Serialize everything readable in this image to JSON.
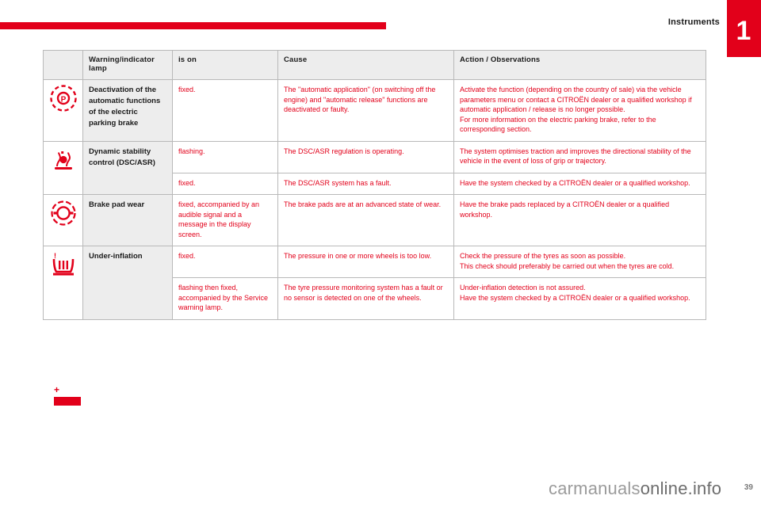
{
  "header": {
    "chapter_title": "Instruments",
    "chapter_number": "1",
    "accent_color": "#e2001a"
  },
  "table": {
    "columns": [
      "Warning/indicator lamp",
      "is on",
      "Cause",
      "Action / Observations"
    ],
    "rows": [
      {
        "icon": "electric-parking-brake-deactivation-icon",
        "lamp": "Deactivation of the automatic functions of the electric parking brake",
        "is_on": "fixed.",
        "cause": "The \"automatic application\" (on switching off the engine) and \"automatic release\" functions are deactivated or faulty.",
        "action": "Activate the function (depending on the country of sale) via the vehicle parameters menu or contact a CITROËN dealer or a qualified workshop if automatic application / release is no longer possible.\nFor more information on the electric parking brake, refer to the corresponding section."
      },
      {
        "icon": "dynamic-stability-control-icon",
        "lamp": "Dynamic stability control (DSC/ASR)",
        "is_on": "flashing.",
        "cause": "The DSC/ASR regulation is operating.",
        "action": "The system optimises traction and improves the directional stability of the vehicle in the event of loss of grip or trajectory."
      },
      {
        "icon": "",
        "lamp": "",
        "is_on": "fixed.",
        "cause": "The DSC/ASR system has a fault.",
        "action": "Have the system checked by a CITROËN dealer or a qualified workshop."
      },
      {
        "icon": "brake-pad-wear-icon",
        "lamp": "Brake pad wear",
        "is_on": "fixed, accompanied by an audible signal and a message in the display screen.",
        "cause": "The brake pads are at an advanced state of wear.",
        "action": "Have the brake pads replaced by a CITROËN dealer or a qualified workshop."
      },
      {
        "icon": "under-inflation-icon",
        "lamp": "Under-inflation",
        "is_on": "fixed.",
        "cause": "The pressure in one or more wheels is too low.",
        "action": "Check the pressure of the tyres as soon as possible.\nThis check should preferably be carried out when the tyres are cold."
      },
      {
        "icon": "",
        "lamp": "",
        "is_on": "flashing then fixed, accompanied by the Service warning lamp.",
        "cause": "The tyre pressure monitoring system has a fault or no sensor is detected on one of the wheels.",
        "action": "Under-inflation detection is not assured.\nHave the system checked by a CITROËN dealer or a qualified workshop."
      }
    ]
  },
  "icon_column_extra": {
    "plus_glyph": "+",
    "bar": "red-bar-marker"
  },
  "footer": {
    "brand_light": "carmanuals",
    "brand_dark": "online.info",
    "page_number": "39"
  }
}
